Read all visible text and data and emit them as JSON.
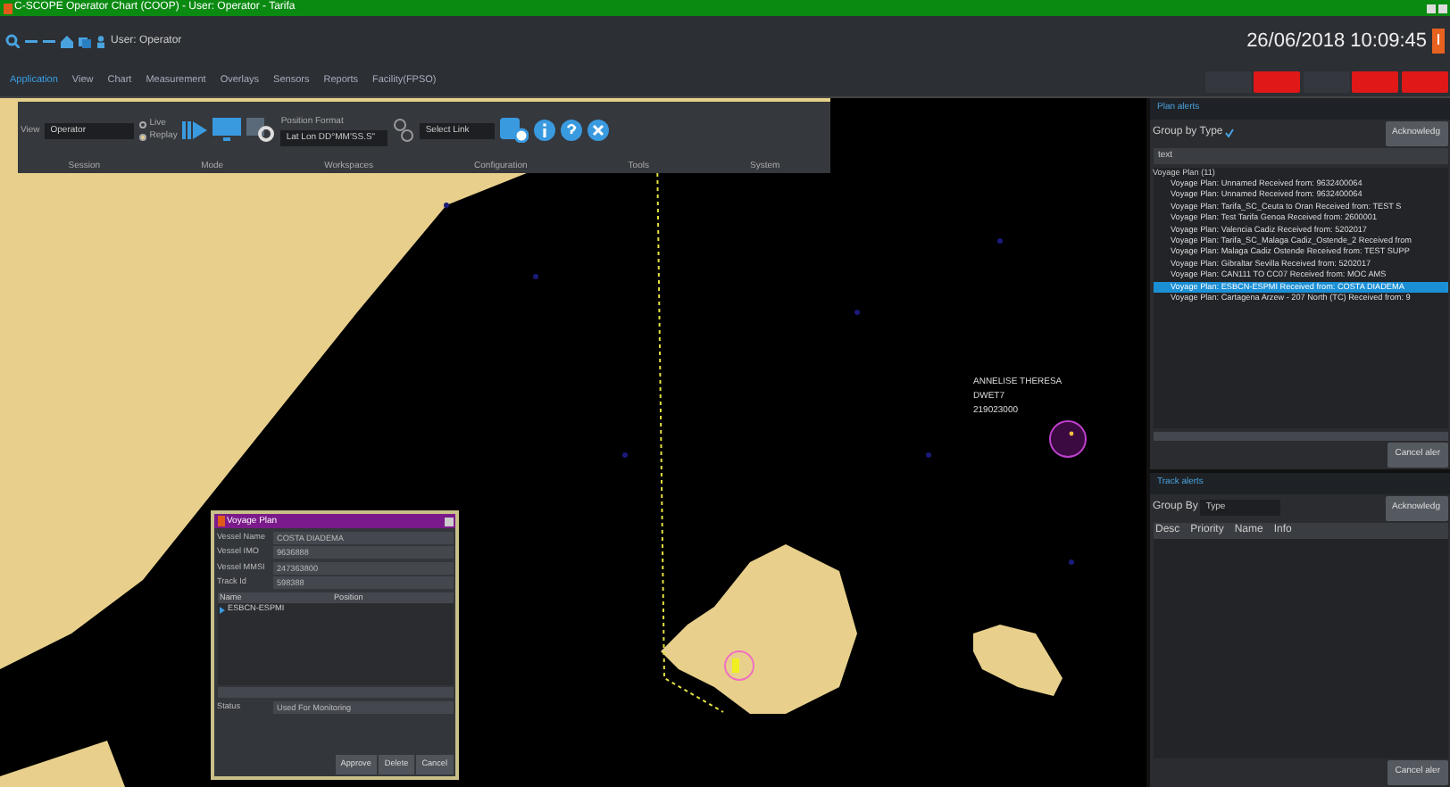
{
  "window": {
    "title": "C-SCOPE Operator Chart (COOP) - User: Operator - Tarifa"
  },
  "toolbar": {
    "user": "User: Operator",
    "datetime": "26/06/2018 10:09:45"
  },
  "menu": [
    {
      "label": "Application",
      "selected": true
    },
    {
      "label": "View",
      "selected": false
    },
    {
      "label": "Chart",
      "selected": false
    },
    {
      "label": "Measurement",
      "selected": false
    },
    {
      "label": "Overlays",
      "selected": false
    },
    {
      "label": "Sensors",
      "selected": false
    },
    {
      "label": "Reports",
      "selected": false
    },
    {
      "label": "Facility(FPSO)",
      "selected": false
    }
  ],
  "status_indicators": [
    {
      "alarm": false
    },
    {
      "alarm": true
    },
    {
      "alarm": false
    },
    {
      "alarm": true
    },
    {
      "alarm": true
    }
  ],
  "ribbon": {
    "view_label": "View",
    "view_value": "Operator",
    "modes": [
      {
        "label": "Live",
        "selected": false
      },
      {
        "label": "Replay",
        "selected": true
      }
    ],
    "position_format_label": "Position Format",
    "position_format": "Lat Lon DD°MM'SS.S\"",
    "link": "Select Link",
    "groups": [
      "Session",
      "Mode",
      "Workspaces",
      "Configuration",
      "Tools",
      "System"
    ]
  },
  "map": {
    "labels": [
      {
        "text": "ANNELISE THERESA"
      },
      {
        "text": "DWET7"
      },
      {
        "text": "219023000"
      }
    ]
  },
  "plan_alerts": {
    "title": "Plan alerts",
    "group_by": "Group by Type",
    "group_checked": true,
    "acknowledge": "Acknowledg",
    "filter": "text",
    "group": "Voyage Plan (11)",
    "items": [
      {
        "text": "Voyage Plan: Unnamed Received from: 9632400064",
        "selected": false
      },
      {
        "text": "Voyage Plan: Unnamed Received from: 9632400064",
        "selected": false
      },
      {
        "text": "Voyage Plan: Tarifa_SC_Ceuta to Oran Received from: TEST S",
        "selected": false
      },
      {
        "text": "Voyage Plan: Test Tarifa Genoa Received from: 2600001",
        "selected": false
      },
      {
        "text": "Voyage Plan: Valencia Cadiz Received from: 5202017",
        "selected": false
      },
      {
        "text": "Voyage Plan: Tarifa_SC_Malaga Cadiz_Ostende_2 Received from",
        "selected": false
      },
      {
        "text": "Voyage Plan: Malaga Cadiz Ostende Received from: TEST SUPP",
        "selected": false
      },
      {
        "text": "Voyage Plan: Gibraltar Sevilla Received from: 5202017",
        "selected": false
      },
      {
        "text": "Voyage Plan: CAN111 TO CC07 Received from: MOC AMS",
        "selected": false
      },
      {
        "text": "Voyage Plan: ESBCN-ESPMI Received from: COSTA DIADEMA",
        "selected": true
      },
      {
        "text": "Voyage Plan: Cartagena Arzew - 207 North (TC) Received from: 9",
        "selected": false
      }
    ],
    "cancel": "Cancel aler"
  },
  "track_alerts": {
    "title": "Track alerts",
    "group_by_label": "Group By",
    "group_by": "Type",
    "acknowledge": "Acknowledg",
    "columns": [
      "Desc",
      "Priority",
      "Name",
      "Info"
    ],
    "cancel": "Cancel aler"
  },
  "dialog": {
    "title": "Voyage Plan",
    "fields": [
      {
        "label": "Vessel Name",
        "value": "COSTA DIADEMA"
      },
      {
        "label": "Vessel IMO",
        "value": "9636888"
      },
      {
        "label": "Vessel MMSI",
        "value": "247363800"
      },
      {
        "label": "Track Id",
        "value": "598388"
      }
    ],
    "columns": [
      "Name",
      "Position"
    ],
    "rows": [
      "ESBCN-ESPMI"
    ],
    "status_label": "Status",
    "status": "Used For Monitoring",
    "buttons": [
      "Approve",
      "Delete",
      "Cancel"
    ]
  }
}
